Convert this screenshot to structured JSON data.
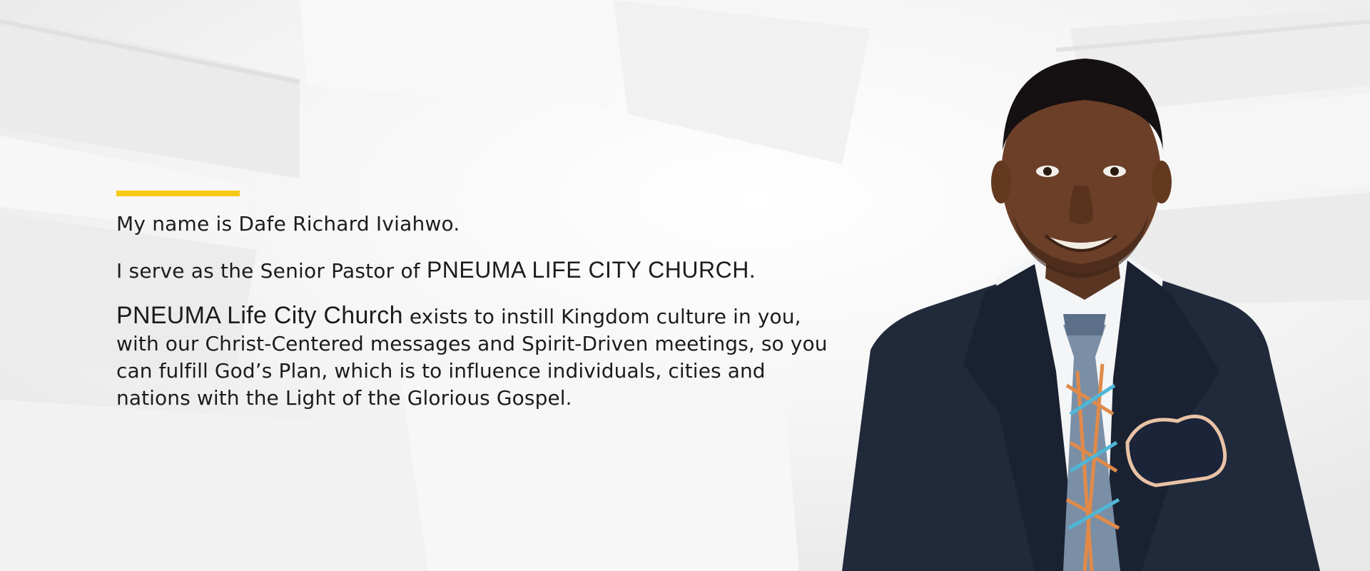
{
  "hero": {
    "intro": "My name is Dafe Richard Iviahwo.",
    "role_prefix": "I serve as the Senior Pastor of ",
    "role_church": "PNEUMA LIFE CITY CHURCH.",
    "mission_church": "PNEUMA Life City Church",
    "mission_text": " exists to instill Kingdom culture in you, with our Christ-Centered messages and Spirit-Driven meetings, so you can fulfill God’s Plan, which is to influence individuals, cities and nations with the Light of the Glorious Gospel.",
    "accent_color": "#f6c914",
    "portrait": "pastor-portrait-photo"
  }
}
